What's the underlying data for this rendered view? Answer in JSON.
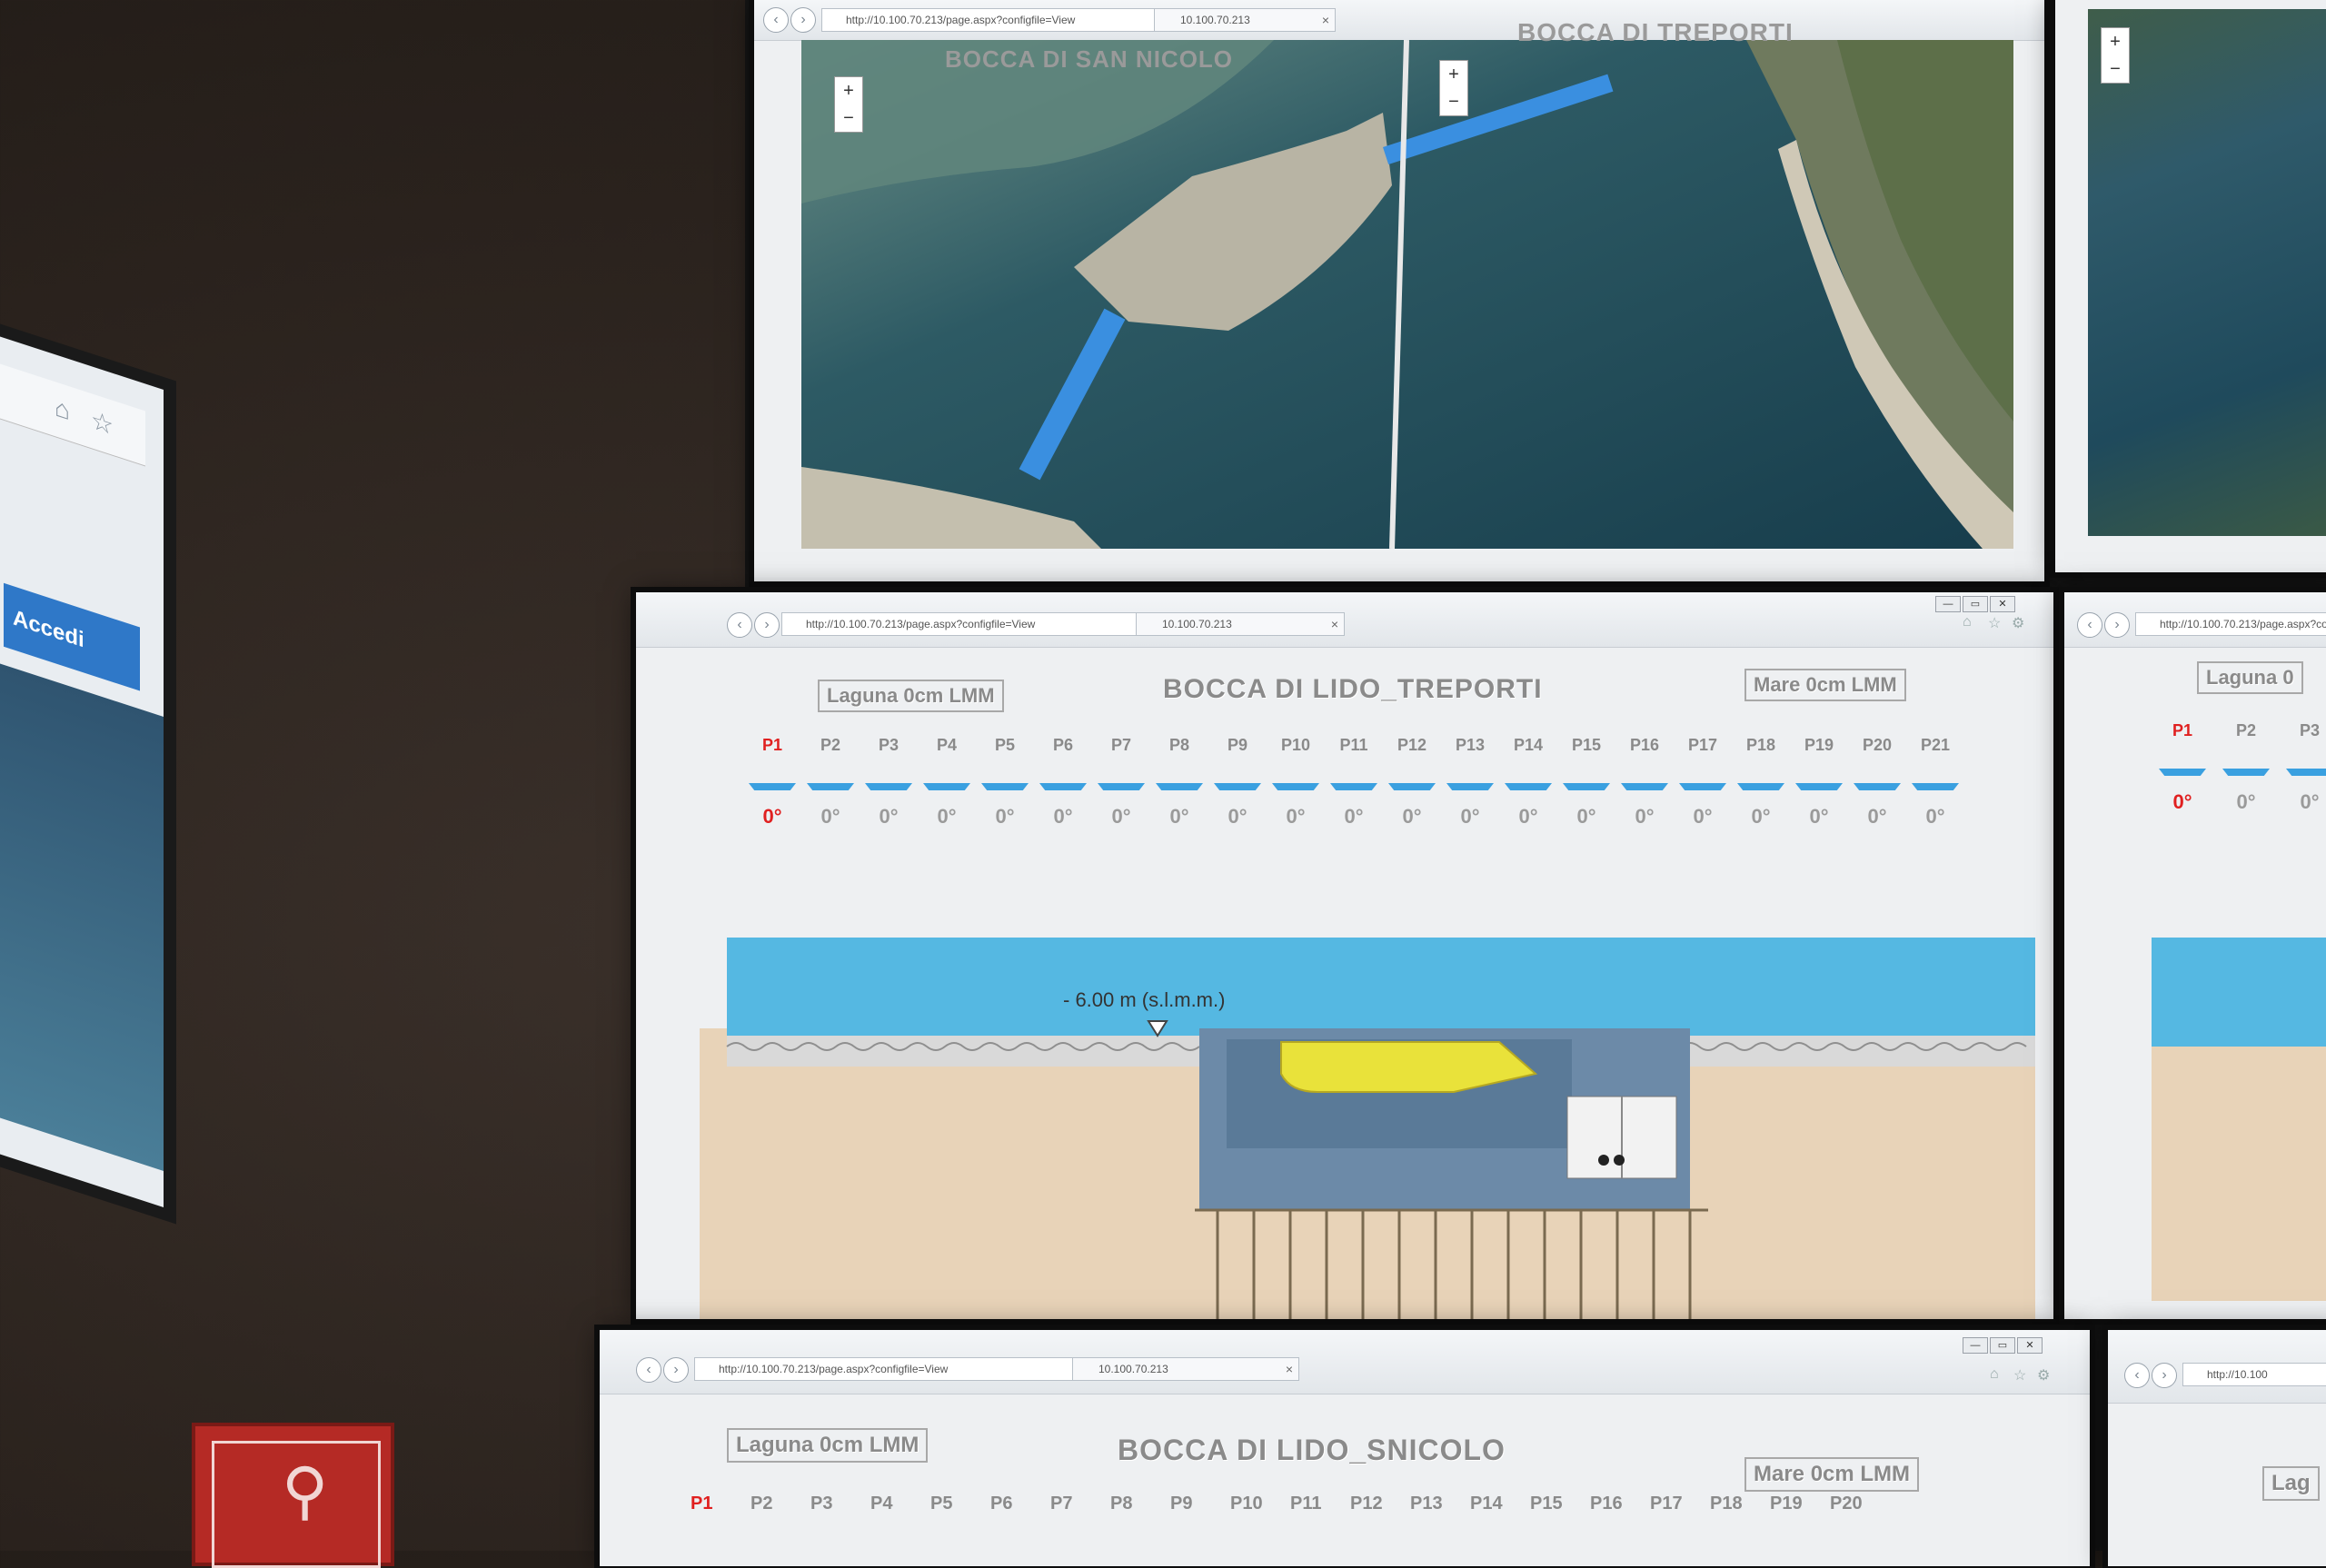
{
  "side_screen": {
    "button_label": "Accedi"
  },
  "browser": {
    "url": "http://10.100.70.213/page.aspx?configfile=View",
    "tab_title": "10.100.70.213"
  },
  "top_panel": {
    "left_label": "BOCCA DI SAN NICOLO",
    "right_label": "BOCCA DI TREPORTI",
    "zoom_in": "+",
    "zoom_out": "−"
  },
  "middle_panel": {
    "title": "BOCCA DI LIDO_TREPORTI",
    "left_ref": "Laguna 0cm LMM",
    "right_ref": "Mare 0cm LMM",
    "depth_label": "- 6.00 m (s.l.m.m.)",
    "gates": [
      {
        "label": "P1",
        "angle": "0°"
      },
      {
        "label": "P2",
        "angle": "0°"
      },
      {
        "label": "P3",
        "angle": "0°"
      },
      {
        "label": "P4",
        "angle": "0°"
      },
      {
        "label": "P5",
        "angle": "0°"
      },
      {
        "label": "P6",
        "angle": "0°"
      },
      {
        "label": "P7",
        "angle": "0°"
      },
      {
        "label": "P8",
        "angle": "0°"
      },
      {
        "label": "P9",
        "angle": "0°"
      },
      {
        "label": "P10",
        "angle": "0°"
      },
      {
        "label": "P11",
        "angle": "0°"
      },
      {
        "label": "P12",
        "angle": "0°"
      },
      {
        "label": "P13",
        "angle": "0°"
      },
      {
        "label": "P14",
        "angle": "0°"
      },
      {
        "label": "P15",
        "angle": "0°"
      },
      {
        "label": "P16",
        "angle": "0°"
      },
      {
        "label": "P17",
        "angle": "0°"
      },
      {
        "label": "P18",
        "angle": "0°"
      },
      {
        "label": "P19",
        "angle": "0°"
      },
      {
        "label": "P20",
        "angle": "0°"
      },
      {
        "label": "P21",
        "angle": "0°"
      }
    ]
  },
  "right_middle_panel": {
    "left_ref": "Laguna 0",
    "gates": [
      {
        "label": "P1",
        "angle": "0°"
      },
      {
        "label": "P2",
        "angle": "0°"
      },
      {
        "label": "P3",
        "angle": "0°"
      }
    ]
  },
  "bottom_panel": {
    "title": "BOCCA DI LIDO_SNICOLO",
    "left_ref": "Laguna 0cm LMM",
    "right_ref": "Mare 0cm LMM",
    "gates": [
      "P1",
      "P2",
      "P3",
      "P4",
      "P5",
      "P6",
      "P7",
      "P8",
      "P9",
      "P10",
      "P11",
      "P12",
      "P13",
      "P14",
      "P15",
      "P16",
      "P17",
      "P18",
      "P19",
      "P20"
    ]
  },
  "right_bottom_panel": {
    "url": "http://10.100",
    "partial_label": "Lag"
  },
  "colors": {
    "gate_active": "#e02020",
    "gate_bar": "#3aa0e0",
    "water": "#55b8e2",
    "sand": "#e8d3b8",
    "gate_body": "#e9e23a"
  }
}
